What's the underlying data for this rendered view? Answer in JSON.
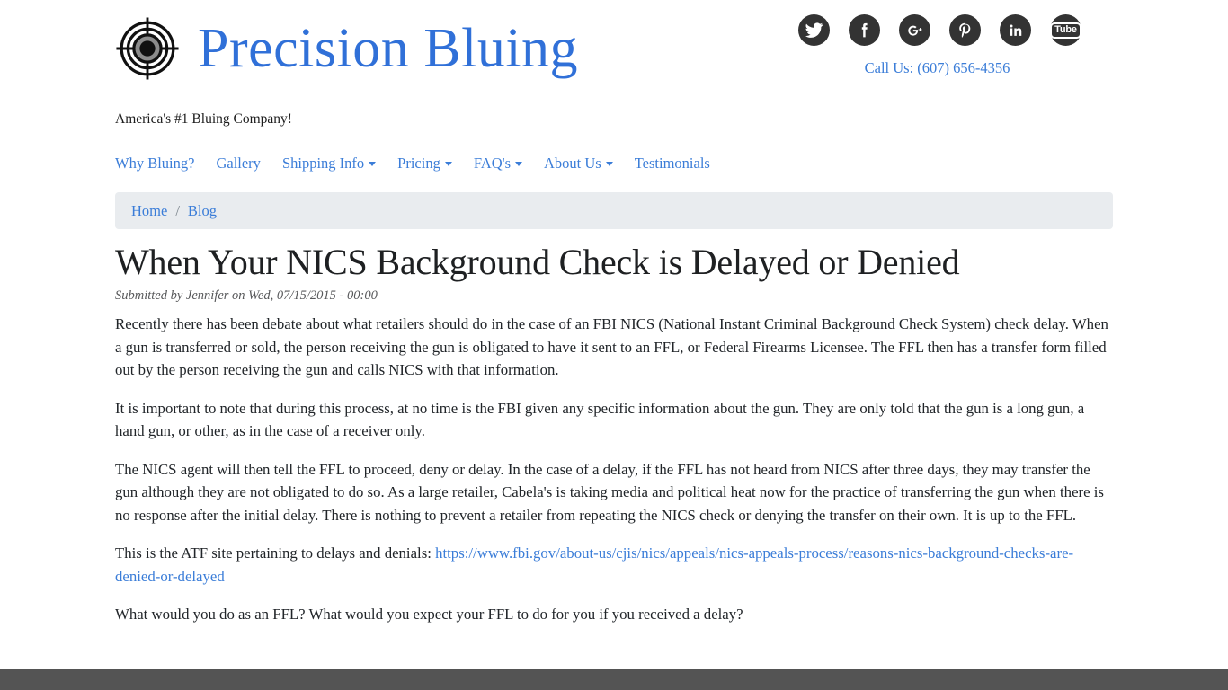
{
  "site": {
    "brand_name": "Precision Bluing",
    "logo_icon": "target-crosshair-icon",
    "tagline": "America's #1 Bluing Company!",
    "phone_label": "Call Us: (607) 656-4356",
    "brand_color": "#3070d8",
    "link_color": "#3b7dd8",
    "footer_color": "#545454",
    "breadcrumb_bg": "#e9ecef"
  },
  "social": [
    {
      "name": "twitter-icon",
      "label": "Twitter"
    },
    {
      "name": "facebook-icon",
      "label": "Facebook"
    },
    {
      "name": "google-plus-icon",
      "label": "Google Plus"
    },
    {
      "name": "pinterest-icon",
      "label": "Pinterest"
    },
    {
      "name": "linkedin-icon",
      "label": "LinkedIn"
    },
    {
      "name": "youtube-icon",
      "label": "Tube"
    }
  ],
  "nav": {
    "items": [
      {
        "label": "Why Bluing?",
        "has_dropdown": false
      },
      {
        "label": "Gallery",
        "has_dropdown": false
      },
      {
        "label": "Shipping Info",
        "has_dropdown": true
      },
      {
        "label": "Pricing",
        "has_dropdown": true
      },
      {
        "label": "FAQ's",
        "has_dropdown": true
      },
      {
        "label": "About Us",
        "has_dropdown": true
      },
      {
        "label": "Testimonials",
        "has_dropdown": false
      }
    ]
  },
  "breadcrumb": {
    "home": "Home",
    "separator": "/",
    "current": "Blog"
  },
  "article": {
    "title": "When Your NICS Background Check is Delayed or Denied",
    "byline": "Submitted by Jennifer on Wed, 07/15/2015 - 00:00",
    "paragraphs": [
      "Recently there has been debate about what retailers should do in the case of an FBI NICS (National Instant Criminal Background Check System) check delay.  When a gun is transferred or sold, the person receiving the gun is obligated to have it sent to an FFL, or Federal Firearms Licensee.  The FFL then has a transfer form filled out by the person receiving the gun and calls NICS with that information.",
      "It is important to note that during this process, at no time is the FBI given any specific information about the gun.  They are only told that the gun is a long gun, a hand gun, or other, as in the case of a receiver only.",
      "The NICS agent will then tell the FFL to proceed, deny or delay.  In the case of a delay, if the FFL has not heard from NICS after three days, they may transfer the gun although they are not obligated to do so.  As a large retailer, Cabela's is taking media and political heat now for the practice of transferring the gun when there is no response after the initial delay.  There is nothing to prevent a retailer from repeating the NICS check or denying the transfer on their own.  It is up to the FFL."
    ],
    "link_paragraph_prefix": "This is the ATF site pertaining to delays and denials: ",
    "link_text": "https://www.fbi.gov/about-us/cjis/nics/appeals/nics-appeals-process/reasons-nics-background-checks-are-denied-or-delayed",
    "closing_paragraph": "What would you do as an FFL?  What would you expect your FFL to do for you if you received a delay?"
  }
}
